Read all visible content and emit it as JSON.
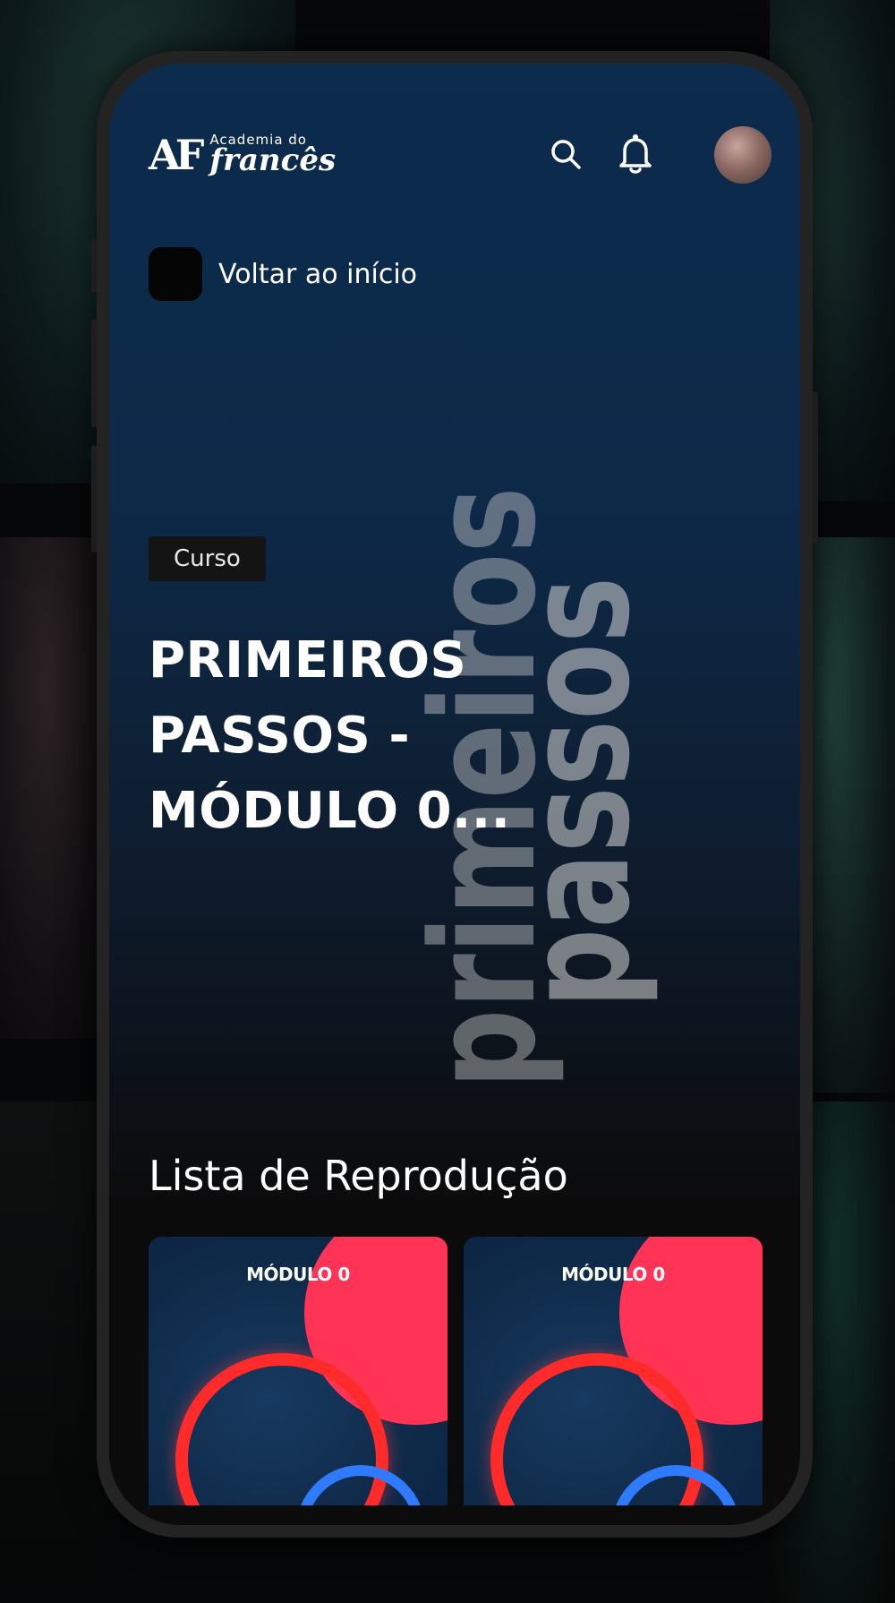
{
  "app": {
    "logo_mark": "AF",
    "logo_top": "Academia do",
    "logo_bottom": "francês"
  },
  "header": {
    "search_icon": "search-icon",
    "bell_icon": "bell-icon"
  },
  "nav": {
    "back_label": "Voltar ao início"
  },
  "course": {
    "badge": "Curso",
    "title": "PRIMEIROS PASSOS - MÓDULO 0...",
    "art_word_1": "primeiros",
    "art_word_2": "passos"
  },
  "playlist": {
    "title": "Lista de Reprodução",
    "items": [
      {
        "label": "MÓDULO 0"
      },
      {
        "label": "MÓDULO 0"
      }
    ]
  },
  "colors": {
    "accent": "#ff3356",
    "screen_top": "#0c2b4d",
    "screen_bottom": "#0b0b0b"
  }
}
